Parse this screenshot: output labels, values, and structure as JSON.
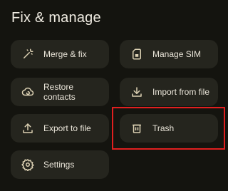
{
  "header": {
    "title": "Fix & manage"
  },
  "tiles": {
    "merge": {
      "label": "Merge & fix",
      "icon": "magic-wand-icon"
    },
    "manage_sim": {
      "label": "Manage SIM",
      "icon": "sim-card-icon"
    },
    "restore": {
      "label": "Restore contacts",
      "icon": "cloud-restore-icon"
    },
    "import": {
      "label": "Import from file",
      "icon": "import-download-icon"
    },
    "export": {
      "label": "Export to file",
      "icon": "export-upload-icon"
    },
    "trash": {
      "label": "Trash",
      "icon": "trash-icon"
    },
    "settings": {
      "label": "Settings",
      "icon": "gear-icon"
    }
  },
  "colors": {
    "background": "#14140f",
    "tile": "#25251e",
    "icon": "#ddd2b4",
    "highlight": "#e01f1f"
  }
}
